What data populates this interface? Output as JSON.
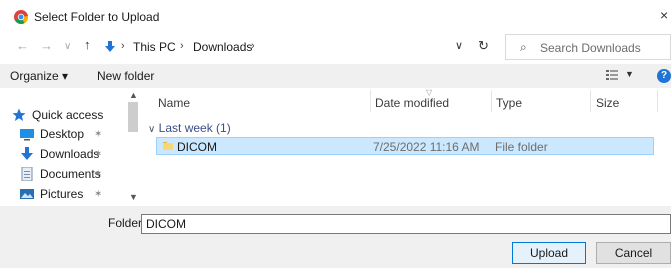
{
  "window": {
    "title": "Select Folder to Upload",
    "close_glyph": "×"
  },
  "nav_buttons": {
    "back": "←",
    "forward": "→",
    "recent": "∨",
    "up": "↑"
  },
  "address": {
    "crumbs": [
      "This PC",
      "Downloads"
    ],
    "dropdown_glyph": "∨",
    "refresh_glyph": "↻"
  },
  "search": {
    "placeholder": "Search Downloads",
    "icon": "search-icon"
  },
  "toolbar": {
    "organize_label": "Organize ▾",
    "new_folder_label": "New folder",
    "help_label": "?"
  },
  "nav_pane": {
    "items": [
      {
        "label": "Quick access",
        "icon": "star-icon",
        "pinned": false
      },
      {
        "label": "Desktop",
        "icon": "desktop-icon",
        "pinned": true
      },
      {
        "label": "Downloads",
        "icon": "download-icon",
        "pinned": true
      },
      {
        "label": "Documents",
        "icon": "documents-icon",
        "pinned": true
      },
      {
        "label": "Pictures",
        "icon": "pictures-icon",
        "pinned": true
      }
    ],
    "pin_glyph": "✶"
  },
  "file_list": {
    "columns": [
      "Name",
      "Date modified",
      "Type",
      "Size"
    ],
    "group_label": "Last week (1)",
    "group_toggle": "∨",
    "rows": [
      {
        "name": "DICOM",
        "date": "7/25/2022 11:16 AM",
        "type": "File folder",
        "size": ""
      }
    ]
  },
  "bottom": {
    "folder_label": "Folder:",
    "folder_value": "DICOM",
    "upload_label": "Upload",
    "cancel_label": "Cancel"
  },
  "colors": {
    "selection_bg": "#cce8ff",
    "selection_border": "#99d1ff",
    "accent": "#0078d7",
    "folder_yellow": "#f8d775"
  }
}
